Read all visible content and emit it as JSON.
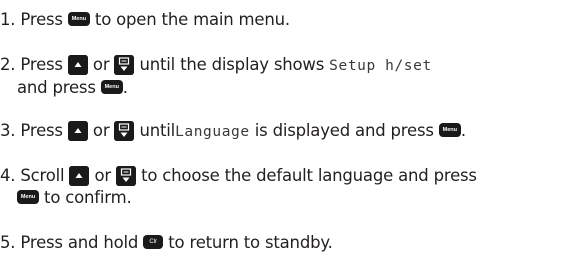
{
  "steps": [
    {
      "number": "1.",
      "before": "Press",
      "key1": "Menu",
      "after": "to open the main menu."
    },
    {
      "number": "2.",
      "before": "Press",
      "or": "or",
      "middle": "until the display shows",
      "display_text": "Setup h/set",
      "line2_before": "and press",
      "key_menu": "Menu",
      "line2_after": "."
    },
    {
      "number": "3.",
      "before": "Press",
      "or": "or",
      "middle": "until",
      "display_text": "Language",
      "after": "is displayed and press",
      "key_menu": "Menu",
      "end": "."
    },
    {
      "number": "4.",
      "before": "Scroll",
      "or": "or",
      "middle": "to choose the default language and press",
      "key_menu": "Menu",
      "line2_after": "to confirm."
    },
    {
      "number": "5.",
      "before": "Press and hold",
      "key_clear": "Clr",
      "after": "to return to standby."
    }
  ],
  "icons": {
    "up": "up-arrow-key-icon",
    "down": "down-arrow-key-icon"
  },
  "colors": {
    "text": "#231f20",
    "key_bg": "#1a1a1a",
    "key_fg": "#ffffff"
  }
}
